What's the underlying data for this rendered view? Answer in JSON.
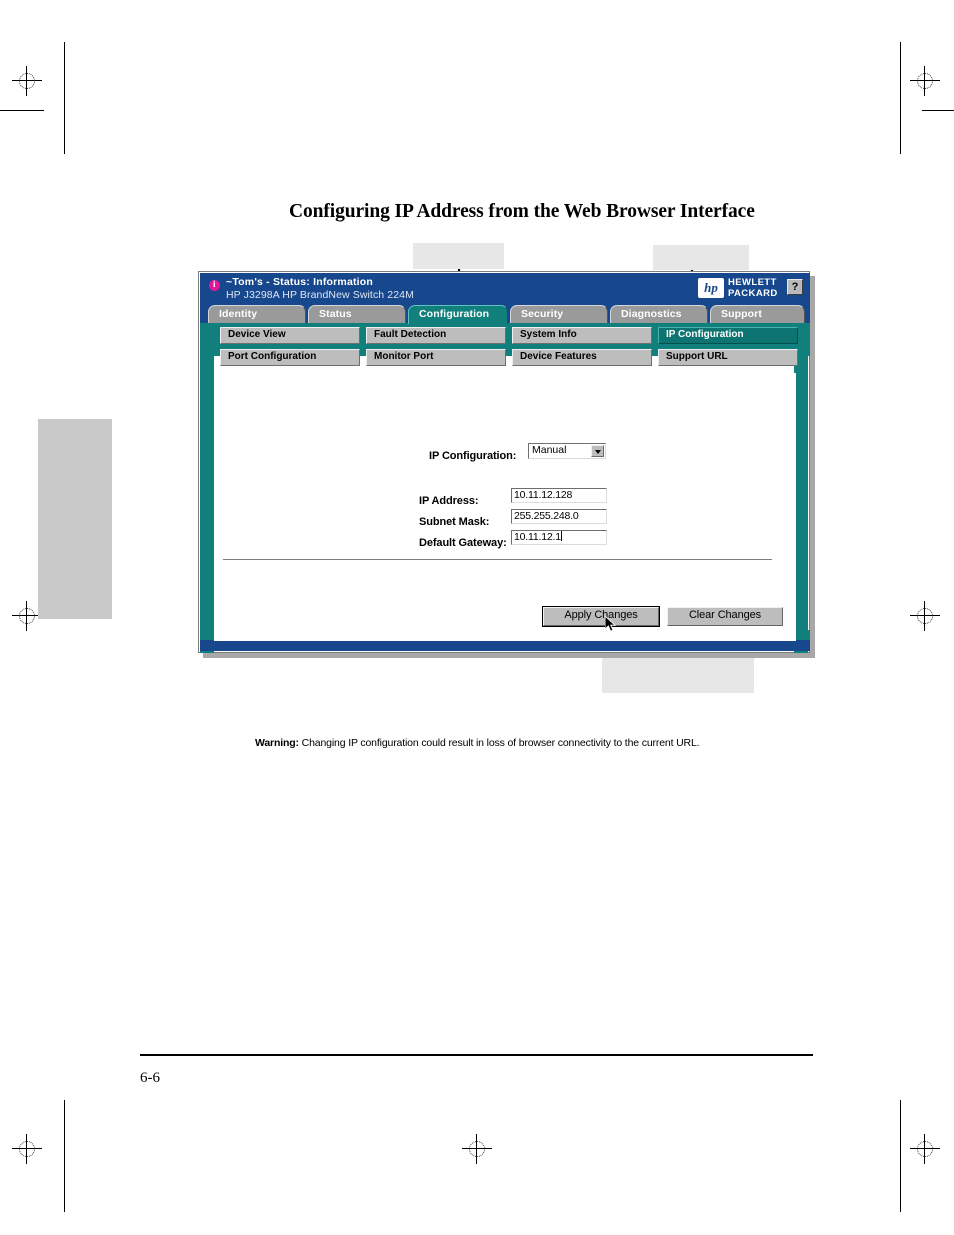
{
  "document": {
    "heading": "Configuring IP Address from the Web Browser Interface",
    "page_number": "6-6"
  },
  "callouts": [
    {
      "name": "callout-configuration-tab",
      "text": ""
    },
    {
      "name": "callout-ip-configuration-button",
      "text": ""
    },
    {
      "name": "callout-ip-configuration-select",
      "text": ""
    },
    {
      "name": "callout-address-fields",
      "text": ""
    },
    {
      "name": "callout-apply-changes",
      "text": ""
    }
  ],
  "webui": {
    "title_bar": {
      "status_icon": "info-icon",
      "line1": "~Tom's - Status: Information",
      "line2": "HP J3298A HP BrandNew Switch 224M",
      "logo_mark": "hp",
      "brand_line1": "HEWLETT",
      "brand_line2": "PACKARD",
      "help_label": "?"
    },
    "tabs": [
      {
        "label": "Identity",
        "active": false
      },
      {
        "label": "Status",
        "active": false
      },
      {
        "label": "Configuration",
        "active": true
      },
      {
        "label": "Security",
        "active": false
      },
      {
        "label": "Diagnostics",
        "active": false
      },
      {
        "label": "Support",
        "active": false
      }
    ],
    "sub_buttons": [
      {
        "label": "Device View",
        "selected": false
      },
      {
        "label": "Fault Detection",
        "selected": false
      },
      {
        "label": "System Info",
        "selected": false
      },
      {
        "label": "IP Configuration",
        "selected": true
      },
      {
        "label": "Port Configuration",
        "selected": false
      },
      {
        "label": "Monitor Port",
        "selected": false
      },
      {
        "label": "Device Features",
        "selected": false
      },
      {
        "label": "Support URL",
        "selected": false
      }
    ],
    "form": {
      "ip_config_label": "IP Configuration:",
      "ip_config_value": "Manual",
      "ip_config_options": [
        "Manual"
      ],
      "ip_address_label": "IP Address:",
      "ip_address_value": "10.11.12.128",
      "subnet_mask_label": "Subnet Mask:",
      "subnet_mask_value": "255.255.248.0",
      "default_gateway_label": "Default Gateway:",
      "default_gateway_value": "10.11.12.1"
    },
    "warning": {
      "prefix": "Warning:",
      "text": " Changing IP configuration could result in loss of browser connectivity to the current URL."
    },
    "buttons": {
      "apply": "Apply Changes",
      "clear": "Clear Changes"
    }
  },
  "colors": {
    "navy": "#17478c",
    "teal": "#11807c",
    "tab_gray": "#9a9a9a",
    "button_gray": "#bdbdbd",
    "magenta": "#e0179b",
    "callout_gray": "#e7e7e7",
    "margin_tab_gray": "#c9c9c9"
  }
}
